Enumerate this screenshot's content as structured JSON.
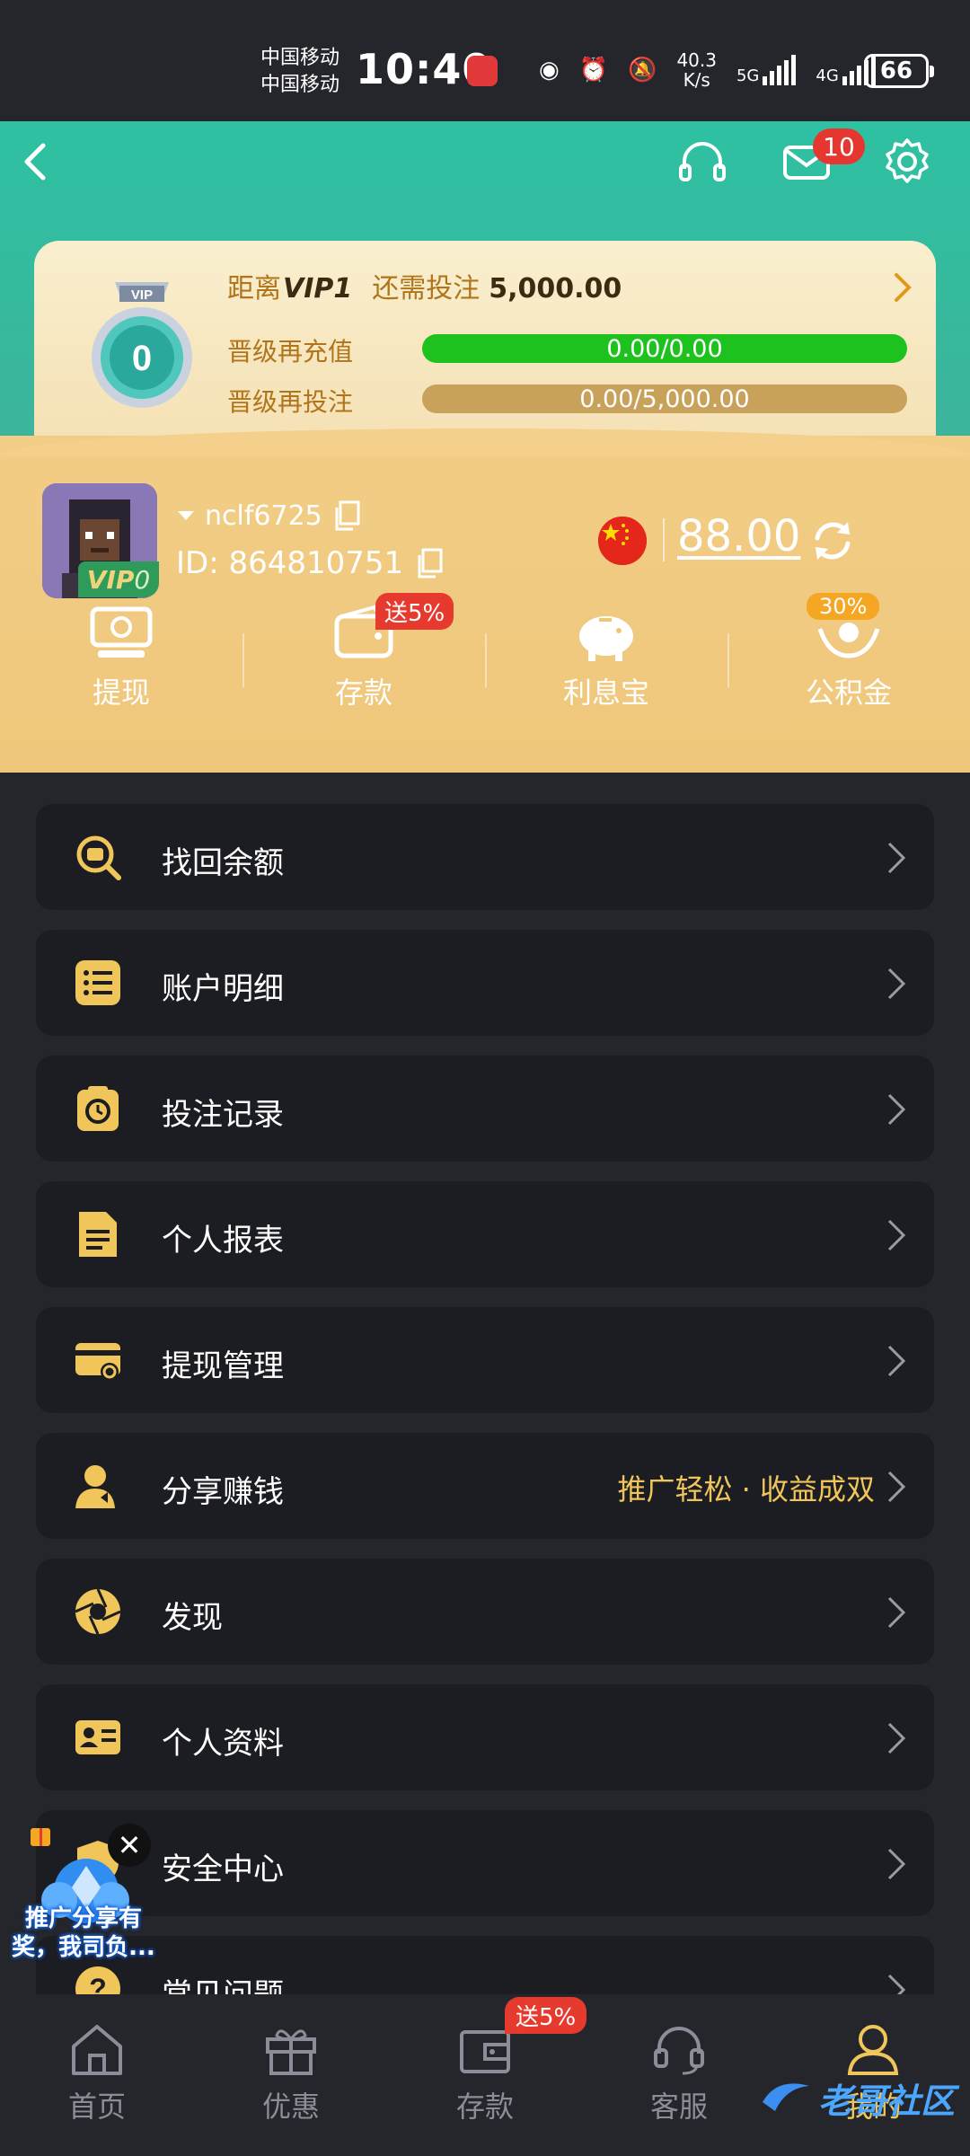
{
  "status_bar": {
    "carrier1": "中国移动",
    "carrier2": "中国移动",
    "time": "10:40",
    "net_speed_value": "40.3",
    "net_speed_unit": "K/s",
    "net_5g": "5G",
    "net_4g": "4G",
    "battery": "66"
  },
  "header": {
    "mail_badge": "10"
  },
  "vip": {
    "medal_level": "0",
    "distance_prefix": "距离",
    "next_level": "VIP1",
    "need_text": "还需投注",
    "need_amount": "5,000.00",
    "recharge_label": "晋级再充值",
    "recharge_progress": "0.00/0.00",
    "recharge_fraction": 1.0,
    "bet_label": "晋级再投注",
    "bet_progress": "0.00/5,000.00",
    "bet_fraction": 0.0
  },
  "user": {
    "username": "nclf6725",
    "user_id": "ID: 864810751",
    "vip_tag_prefix": "VIP",
    "vip_tag_level": "0",
    "balance": "88.00"
  },
  "quick_actions": [
    {
      "label": "提现"
    },
    {
      "label": "存款",
      "badge": "送5%"
    },
    {
      "label": "利息宝"
    },
    {
      "label": "公积金",
      "badge": "30%"
    }
  ],
  "menu": [
    {
      "label": "找回余额"
    },
    {
      "label": "账户明细"
    },
    {
      "label": "投注记录"
    },
    {
      "label": "个人报表"
    },
    {
      "label": "提现管理"
    },
    {
      "label": "分享赚钱",
      "extra": "推广轻松 · 收益成双"
    },
    {
      "label": "发现"
    },
    {
      "label": "个人资料"
    },
    {
      "label": "安全中心"
    },
    {
      "label": "常见问题"
    }
  ],
  "promo": {
    "text_line1": "推广分享有",
    "text_line2": "奖，我司负..."
  },
  "bottom_nav": {
    "items": [
      {
        "label": "首页"
      },
      {
        "label": "优惠"
      },
      {
        "label": "存款"
      },
      {
        "label": "客服"
      },
      {
        "label": "我的"
      }
    ],
    "deposit_badge": "送5%"
  },
  "watermark": "老哥社区",
  "colors": {
    "accent_gold": "#f0c65a",
    "header_teal": "#2ec1a2",
    "panel_gold": "#f2cd86",
    "menu_bg": "#1c1d22",
    "badge_red": "#e73a2f",
    "progress_green": "#1ec21e"
  }
}
